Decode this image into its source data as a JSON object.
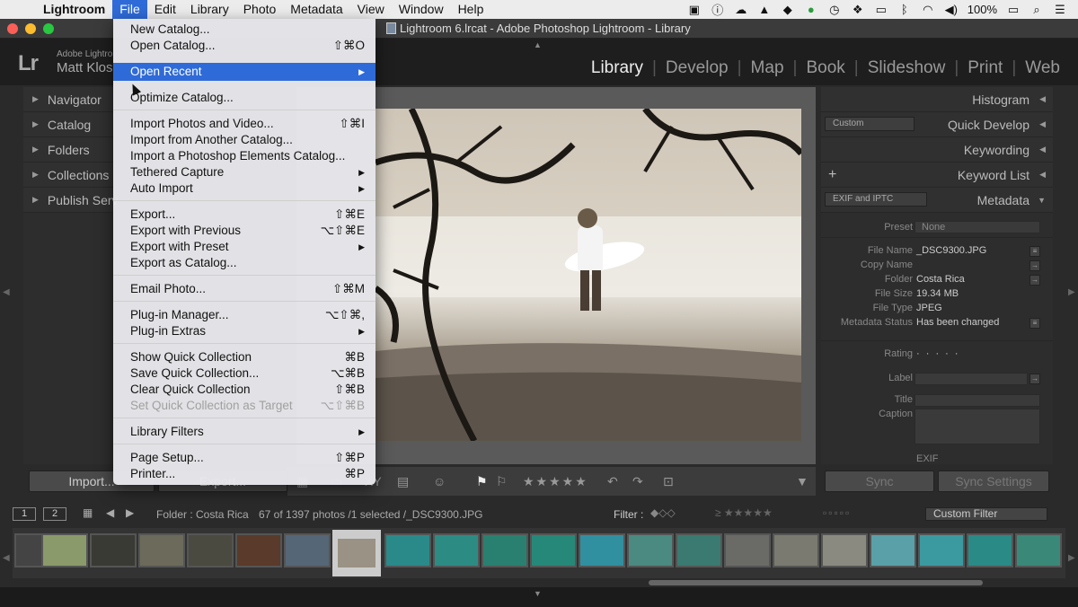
{
  "menubar": {
    "app_name": "Lightroom",
    "items": [
      "File",
      "Edit",
      "Library",
      "Photo",
      "Metadata",
      "View",
      "Window",
      "Help"
    ],
    "active_item": "File",
    "battery": "100%"
  },
  "window": {
    "title": "Lightroom 6.lrcat - Adobe Photoshop Lightroom - Library"
  },
  "identity_plate": {
    "small_text": "Adobe Lightro",
    "name": "Matt Klos",
    "logo": "Lr"
  },
  "modules": [
    "Library",
    "Develop",
    "Map",
    "Book",
    "Slideshow",
    "Print",
    "Web"
  ],
  "active_module": "Library",
  "left_panel": {
    "items": [
      "Navigator",
      "Catalog",
      "Folders",
      "Collections",
      "Publish Serv"
    ],
    "import_label": "Import...",
    "export_label": "Export..."
  },
  "right_panel": {
    "histogram": "Histogram",
    "quick_develop": "Quick Develop",
    "quick_develop_preset": "Custom",
    "keywording": "Keywording",
    "keyword_list": "Keyword List",
    "metadata": "Metadata",
    "metadata_preset_select": "EXIF and IPTC",
    "preset_label": "Preset",
    "preset_value": "None",
    "rows": [
      {
        "key": "File Name",
        "value": "_DSC9300.JPG"
      },
      {
        "key": "Copy Name",
        "value": ""
      },
      {
        "key": "Folder",
        "value": "Costa Rica"
      },
      {
        "key": "File Size",
        "value": "19.34 MB"
      },
      {
        "key": "File Type",
        "value": "JPEG"
      },
      {
        "key": "Metadata Status",
        "value": "Has been changed"
      }
    ],
    "rating_label": "Rating",
    "rating_dots": "· · · · ·",
    "label_label": "Label",
    "title_label": "Title",
    "caption_label": "Caption",
    "exif_label": "EXIF",
    "sync_label": "Sync",
    "sync_settings_label": "Sync Settings"
  },
  "filmbar": {
    "page1": "1",
    "page2": "2",
    "folder_text": "Folder : Costa Rica",
    "count_text": "67 of 1397 photos /1 selected /_DSC9300.JPG",
    "filter_label": "Filter :",
    "custom_filter": "Custom Filter"
  },
  "file_menu": {
    "items": [
      {
        "label": "New Catalog...",
        "shortcut": ""
      },
      {
        "label": "Open Catalog...",
        "shortcut": "⇧⌘O"
      },
      {
        "label": "Open Recent",
        "shortcut": "",
        "submenu": true,
        "highlighted": true
      },
      {
        "label": "Optimize Catalog...",
        "shortcut": ""
      },
      {
        "label": "Import Photos and Video...",
        "shortcut": "⇧⌘I"
      },
      {
        "label": "Import from Another Catalog...",
        "shortcut": ""
      },
      {
        "label": "Import a Photoshop Elements Catalog...",
        "shortcut": ""
      },
      {
        "label": "Tethered Capture",
        "shortcut": "",
        "submenu": true
      },
      {
        "label": "Auto Import",
        "shortcut": "",
        "submenu": true
      },
      {
        "label": "Export...",
        "shortcut": "⇧⌘E"
      },
      {
        "label": "Export with Previous",
        "shortcut": "⌥⇧⌘E"
      },
      {
        "label": "Export with Preset",
        "shortcut": "",
        "submenu": true
      },
      {
        "label": "Export as Catalog...",
        "shortcut": ""
      },
      {
        "label": "Email Photo...",
        "shortcut": "⇧⌘M"
      },
      {
        "label": "Plug-in Manager...",
        "shortcut": "⌥⇧⌘,"
      },
      {
        "label": "Plug-in Extras",
        "shortcut": "",
        "submenu": true
      },
      {
        "label": "Show Quick Collection",
        "shortcut": "⌘B"
      },
      {
        "label": "Save Quick Collection...",
        "shortcut": "⌥⌘B"
      },
      {
        "label": "Clear Quick Collection",
        "shortcut": "⇧⌘B"
      },
      {
        "label": "Set Quick Collection as Target",
        "shortcut": "⌥⇧⌘B",
        "disabled": true
      },
      {
        "label": "Library Filters",
        "shortcut": "",
        "submenu": true
      },
      {
        "label": "Page Setup...",
        "shortcut": "⇧⌘P"
      },
      {
        "label": "Printer...",
        "shortcut": "⌘P"
      }
    ]
  },
  "colors": {
    "highlight": "#2f6bd8",
    "panel_bg": "#2d2d2d",
    "menu_bg": "#e8e8ec"
  }
}
